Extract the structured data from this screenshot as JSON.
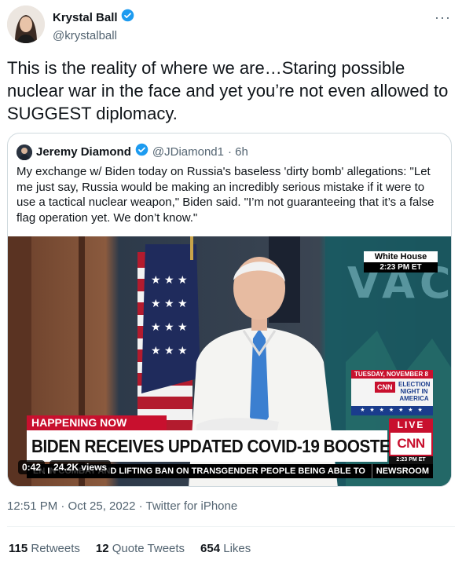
{
  "author": {
    "name": "Krystal Ball",
    "handle": "@krystalball",
    "verified_icon": "verified-badge-icon",
    "more_label": "···"
  },
  "tweet": {
    "text": "This is the reality of where we are…Staring possible nuclear war in the face and yet you’re not even allowed to SUGGEST diplomacy."
  },
  "quoted": {
    "name": "Jeremy Diamond",
    "handle": "@JDiamond1",
    "age": "· 6h",
    "text": "My exchange w/ Biden today on Russia's baseless 'dirty bomb' allegations: \"Let me just say, Russia would be making an incredibly serious mistake if it were to use a tactical nuclear weapon,\" Biden said. \"I’m not guaranteeing that it’s a false flag operation yet. We don’t know.\""
  },
  "video": {
    "location": "White House",
    "clock": "2:23 PM ET",
    "backdrop_text": "VAC",
    "promo_date": "TUESDAY, NOVEMBER 8",
    "promo_logo": "CNN",
    "promo_title": "ELECTION NIGHT IN AMERICA",
    "promo_stars": "★ ★ ★ ★ ★ ★ ★",
    "happening": "HAPPENING NOW",
    "headline": "BIDEN RECEIVES UPDATED COVID-19 BOOSTER",
    "live": "LIVE",
    "network": "CNN",
    "network_time": "2:23 PM ET",
    "ticker": "EN IN COMBAT AND LIFTING BAN ON TRANSGENDER PEOPLE BEING ABLE TO",
    "ticker_tag": "NEWSROOM",
    "duration": "0:42",
    "views": "24.2K views"
  },
  "timestamp": "12:51 PM · Oct 25, 2022 · Twitter for iPhone",
  "stats": {
    "retweets_count": "115",
    "retweets_label": "Retweets",
    "quotes_count": "12",
    "quotes_label": "Quote Tweets",
    "likes_count": "654",
    "likes_label": "Likes"
  },
  "colors": {
    "accent": "#1d9bf0",
    "muted": "#536471",
    "cnn_red": "#c8102e"
  }
}
